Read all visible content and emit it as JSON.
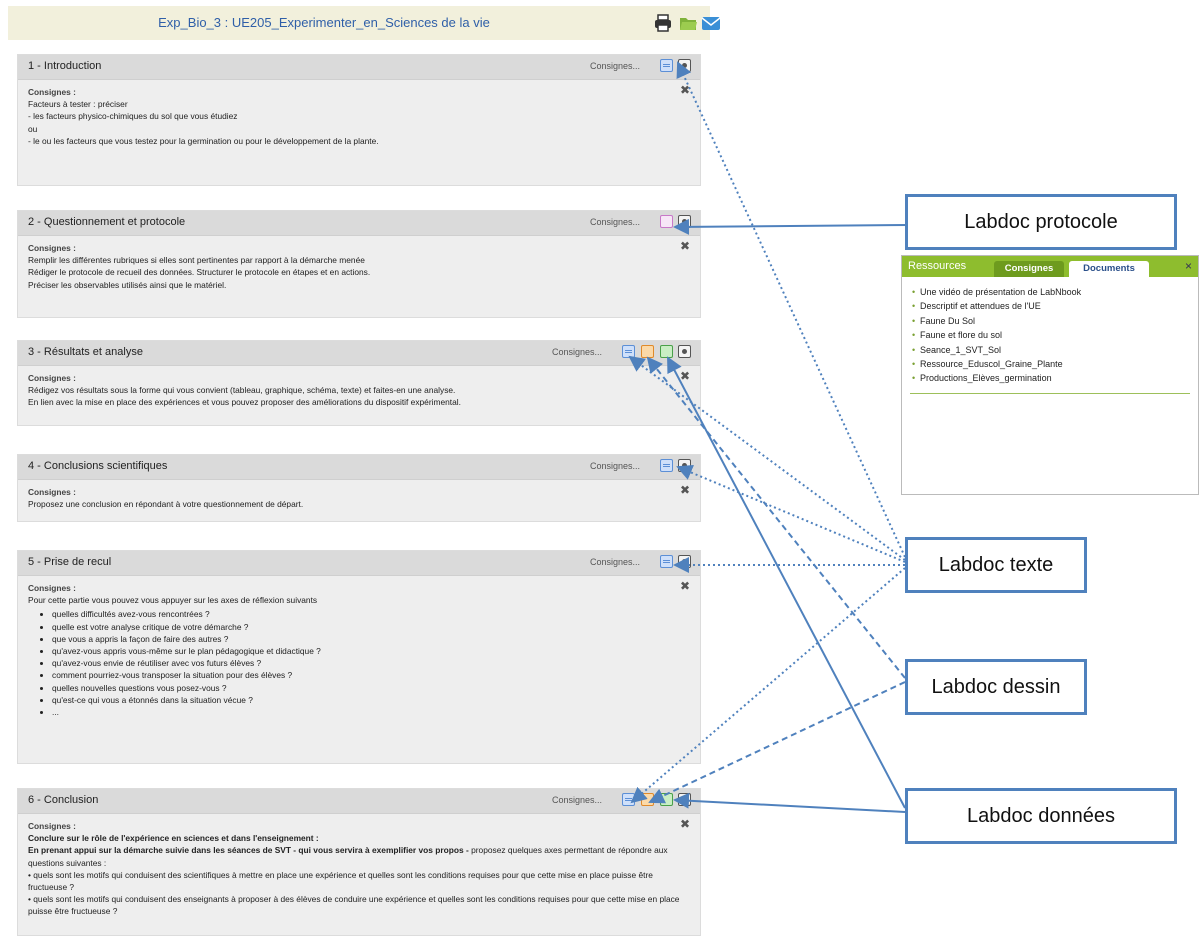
{
  "header": {
    "title": "Exp_Bio_3 : UE205_Experimenter_en_Sciences de la vie",
    "icons": [
      "print-icon",
      "folder-icon",
      "mail-icon"
    ]
  },
  "consignes_button": "Consignes...",
  "consignes_label": "Consignes :",
  "sections": [
    {
      "title": "1 - Introduction",
      "lines": [
        "Facteurs à tester : préciser",
        "- les facteurs physico-chimiques du sol que vous étudiez",
        "ou",
        "- le ou les facteurs que vous testez pour la germination ou pour le développement de la plante."
      ]
    },
    {
      "title": "2 - Questionnement et protocole",
      "lines": [
        "Remplir les différentes rubriques si elles sont pertinentes par rapport à la démarche menée",
        "Rédiger le protocole de recueil des données. Structurer le protocole en étapes et en actions.",
        "Préciser les observables utilisés ainsi que le matériel."
      ]
    },
    {
      "title": "3 - Résultats et analyse",
      "lines": [
        "Rédigez vos résultats sous la forme qui vous convient (tableau, graphique, schéma, texte) et faites-en une analyse.",
        "En lien avec la mise en place des expériences et vous pouvez proposer des améliorations du dispositif expérimental."
      ]
    },
    {
      "title": "4 - Conclusions scientifiques",
      "lines": [
        "Proposez une conclusion en répondant à votre questionnement de départ."
      ]
    },
    {
      "title": "5 - Prise de recul",
      "intro": "Pour cette partie vous pouvez vous appuyer sur les axes de réflexion suivants",
      "bullets": [
        "quelles difficultés avez-vous rencontrées ?",
        "quelle est votre analyse critique de votre démarche ?",
        "que vous a appris la façon de faire des autres ?",
        "qu'avez-vous appris vous-même sur le plan pédagogique et didactique ?",
        "qu'avez-vous envie de réutiliser avec vos futurs élèves ?",
        "comment pourriez-vous transposer la situation pour des élèves ?",
        "quelles nouvelles questions vous posez-vous ?",
        "qu'est-ce qui vous a étonnés dans la situation vécue ?",
        "..."
      ]
    },
    {
      "title": "6 - Conclusion",
      "bold1": "Conclure sur le rôle de l'expérience en sciences et dans l'enseignement :",
      "bold2": "En prenant appui sur la démarche suivie dans les séances de SVT - qui vous servira à exemplifier vos propos -",
      "rest2": " proposez quelques axes permettant de répondre aux questions suivantes :",
      "q1": "• quels sont les motifs qui conduisent des scientifiques à mettre en place une expérience et quelles sont les conditions requises pour que cette mise en place puisse être fructueuse ?",
      "q2": "• quels sont les motifs qui conduisent des enseignants à proposer à des élèves de conduire une expérience et quelles sont les conditions requises pour que cette mise en place puisse être fructueuse ?"
    }
  ],
  "labels": {
    "protocole": "Labdoc protocole",
    "texte": "Labdoc texte",
    "dessin": "Labdoc dessin",
    "donnees": "Labdoc données"
  },
  "resources": {
    "title": "Ressources",
    "tab_active": "Consignes",
    "tab_inactive": "Documents",
    "close": "×",
    "items": [
      "Une vidéo de présentation de LabNbook",
      "Descriptif et attendues de l'UE",
      "Faune Du Sol",
      "Faune et flore du sol",
      "Seance_1_SVT_Sol",
      "Ressource_Eduscol_Graine_Plante",
      "Productions_Elèves_germination"
    ]
  },
  "colors": {
    "accent_blue": "#4f81bd",
    "resources_green": "#8ebd2e",
    "title_blue": "#2f5fa8"
  }
}
